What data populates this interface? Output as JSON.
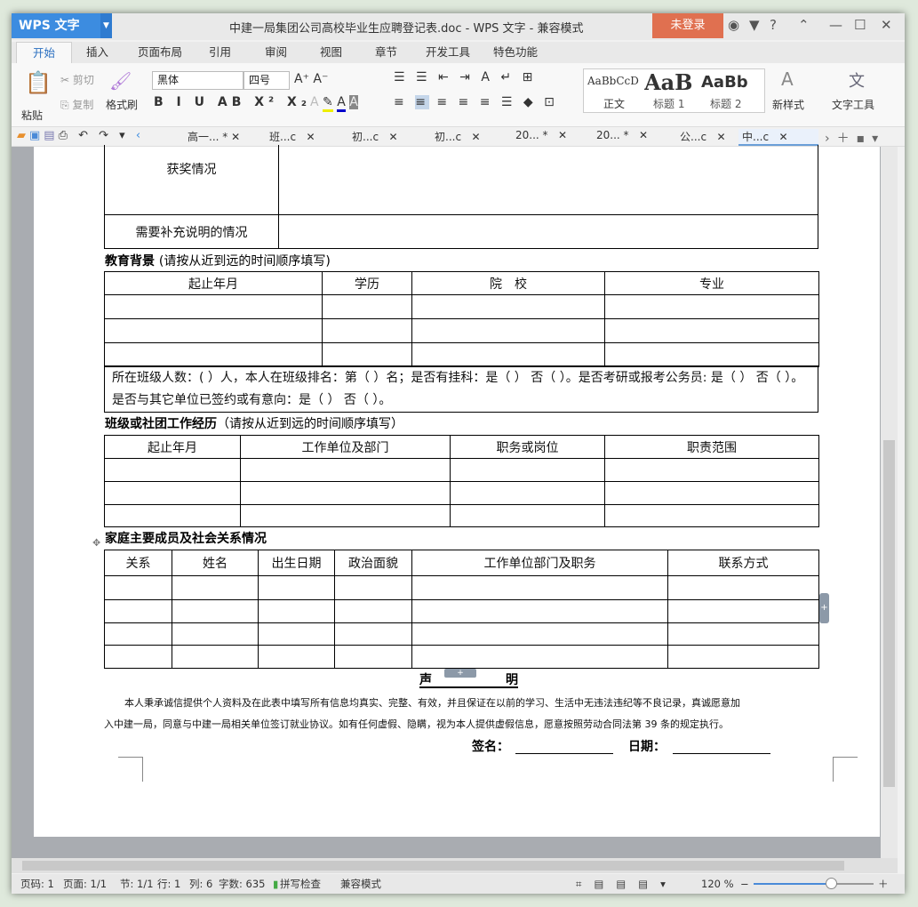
{
  "window": {
    "app_button": "WPS 文字",
    "title": "中建一局集团公司高校毕业生应聘登记表.doc - WPS 文字 - 兼容模式",
    "login": "未登录",
    "help": "?"
  },
  "menu_tabs": [
    "开始",
    "插入",
    "页面布局",
    "引用",
    "审阅",
    "视图",
    "章节",
    "开发工具",
    "特色功能"
  ],
  "ribbon": {
    "paste": "粘贴",
    "cut": "剪切",
    "copy": "复制",
    "format_painter": "格式刷",
    "font": "黑体",
    "size": "四号",
    "styles": [
      {
        "preview": "AaBbCcD",
        "label": "正文"
      },
      {
        "preview": "AaB",
        "label": "标题 1"
      },
      {
        "preview": "AaBb",
        "label": "标题 2"
      }
    ],
    "new_style": "新样式",
    "text_tools": "文字工具"
  },
  "doc_tabs": [
    "高一... *",
    "班...c",
    "初...c",
    "初...c",
    "20... *",
    "20... *",
    "公...c",
    "中...c"
  ],
  "document": {
    "awards": "获奖情况",
    "extra": "需要补充说明的情况",
    "edu_heading": "教育背景",
    "edu_note": "(请按从近到远的时间顺序填写)",
    "edu_headers": [
      "起止年月",
      "学历",
      "院　校",
      "专业"
    ],
    "edu_info": "所在班级人数：( ）人，本人在班级排名：第（ ）名；是否有挂科：是（ ） 否（ ）。是否考研或报考公务员: 是（ ） 否（ ）。是否与其它单位已签约或有意向：是（ ） 否（ ）。",
    "work_heading": "班级或社团工作经历",
    "work_note": "（请按从近到远的时间顺序填写）",
    "work_headers": [
      "起止年月",
      "工作单位及部门",
      "职务或岗位",
      "职责范围"
    ],
    "family_heading": "家庭主要成员及社会关系情况",
    "family_headers": [
      "关系",
      "姓名",
      "出生日期",
      "政治面貌",
      "工作单位部门及职务",
      "联系方式"
    ],
    "decl_title_1": "声",
    "decl_title_2": "明",
    "decl_line1": "本人秉承诚信提供个人资料及在此表中填写所有信息均真实、完整、有效，并且保证在以前的学习、生活中无违法违纪等不良记录，真诚愿意加",
    "decl_line2": "入中建一局，同意与中建一局相关单位签订就业协议。如有任何虚假、隐瞒，视为本人提供虚假信息，愿意按照劳动合同法第 39 条的规定执行。",
    "sign": "签名：",
    "date": "日期："
  },
  "status": {
    "page_no": "页码: 1",
    "pages": "页面: 1/1",
    "section": "节: 1/1",
    "row": "行: 1",
    "col": "列: 6",
    "words": "字数: 635",
    "spell": "拼写检查",
    "compat": "兼容模式",
    "zoom": "120 %",
    "zoom_percent": 120
  },
  "colors": {
    "accent": "#3c8ce0",
    "login": "#e07050"
  }
}
